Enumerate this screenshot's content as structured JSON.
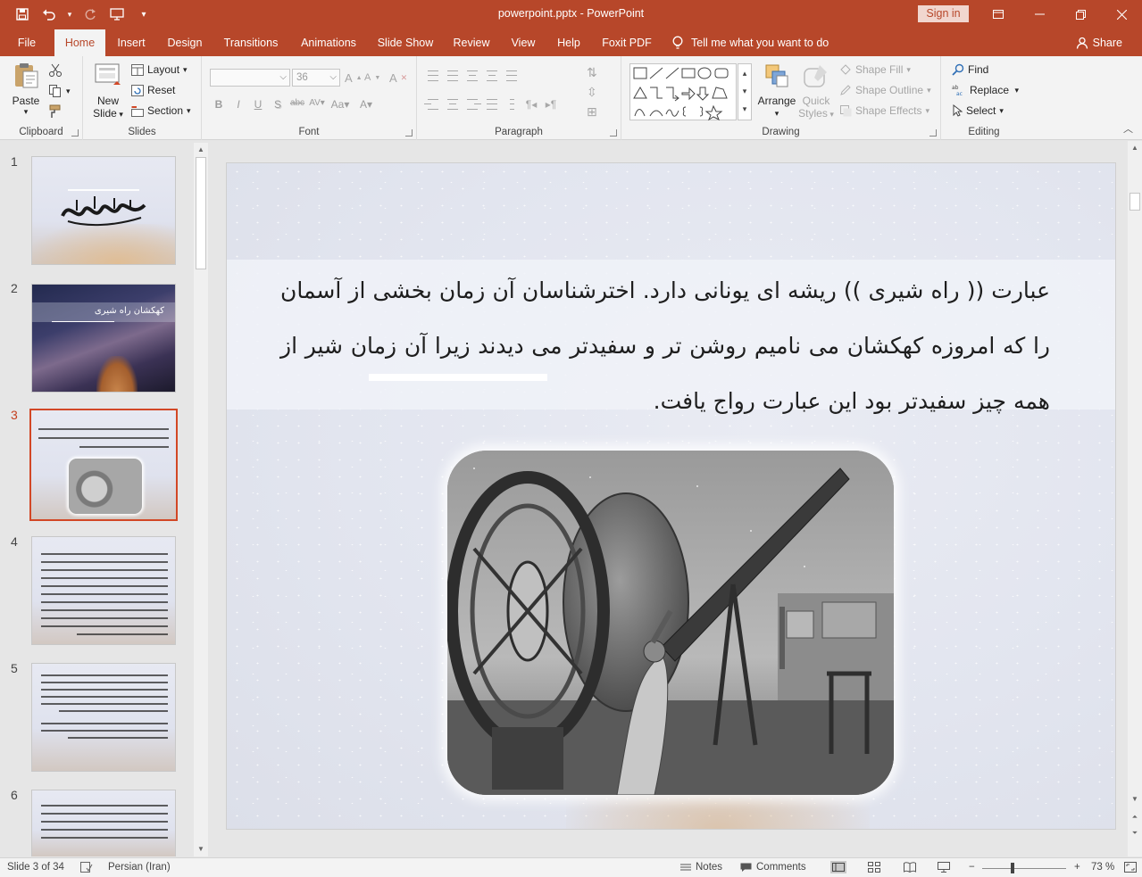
{
  "titlebar": {
    "title": "powerpoint.pptx  -  PowerPoint",
    "sign_in": "Sign in",
    "bg_color": "#b7472a"
  },
  "tabs": [
    {
      "label": "File"
    },
    {
      "label": "Home"
    },
    {
      "label": "Insert"
    },
    {
      "label": "Design"
    },
    {
      "label": "Transitions"
    },
    {
      "label": "Animations"
    },
    {
      "label": "Slide Show"
    },
    {
      "label": "Review"
    },
    {
      "label": "View"
    },
    {
      "label": "Help"
    },
    {
      "label": "Foxit PDF"
    }
  ],
  "tell_me": "Tell me what you want to do",
  "share": "Share",
  "ribbon": {
    "clipboard": {
      "paste": "Paste",
      "label": "Clipboard"
    },
    "slides": {
      "new_slide_1": "New",
      "new_slide_2": "Slide",
      "layout": "Layout",
      "reset": "Reset",
      "section": "Section",
      "label": "Slides"
    },
    "font": {
      "font_size": "36",
      "label": "Font"
    },
    "paragraph": {
      "label": "Paragraph"
    },
    "drawing": {
      "arrange": "Arrange",
      "quick_styles_1": "Quick",
      "quick_styles_2": "Styles",
      "shape_fill": "Shape Fill",
      "shape_outline": "Shape Outline",
      "shape_effects": "Shape Effects",
      "label": "Drawing"
    },
    "editing": {
      "find": "Find",
      "replace": "Replace",
      "select": "Select",
      "label": "Editing"
    }
  },
  "thumbnails": [
    {
      "num": "1"
    },
    {
      "num": "2",
      "title": "کهکشان راه شیری"
    },
    {
      "num": "3"
    },
    {
      "num": "4"
    },
    {
      "num": "5"
    },
    {
      "num": "6"
    }
  ],
  "slide": {
    "paragraph": "عبارت (( راه شیری )) ریشه ای یونانی دارد. اخترشناسان آن زمان بخشی از آسمان را که امروزه کهکشان می نامیم روشن تر و سفیدتر می دیدند زیرا آن زمان شیر از همه چیز سفیدتر بود این عبارت رواج یافت."
  },
  "status": {
    "slide_of": "Slide 3 of 34",
    "language": "Persian (Iran)",
    "notes": "Notes",
    "comments": "Comments",
    "zoom_minus": "−",
    "zoom_plus": "+",
    "zoom": "73 %"
  },
  "colors": {
    "accent": "#b7472a",
    "selected_thumb": "#d24726"
  }
}
